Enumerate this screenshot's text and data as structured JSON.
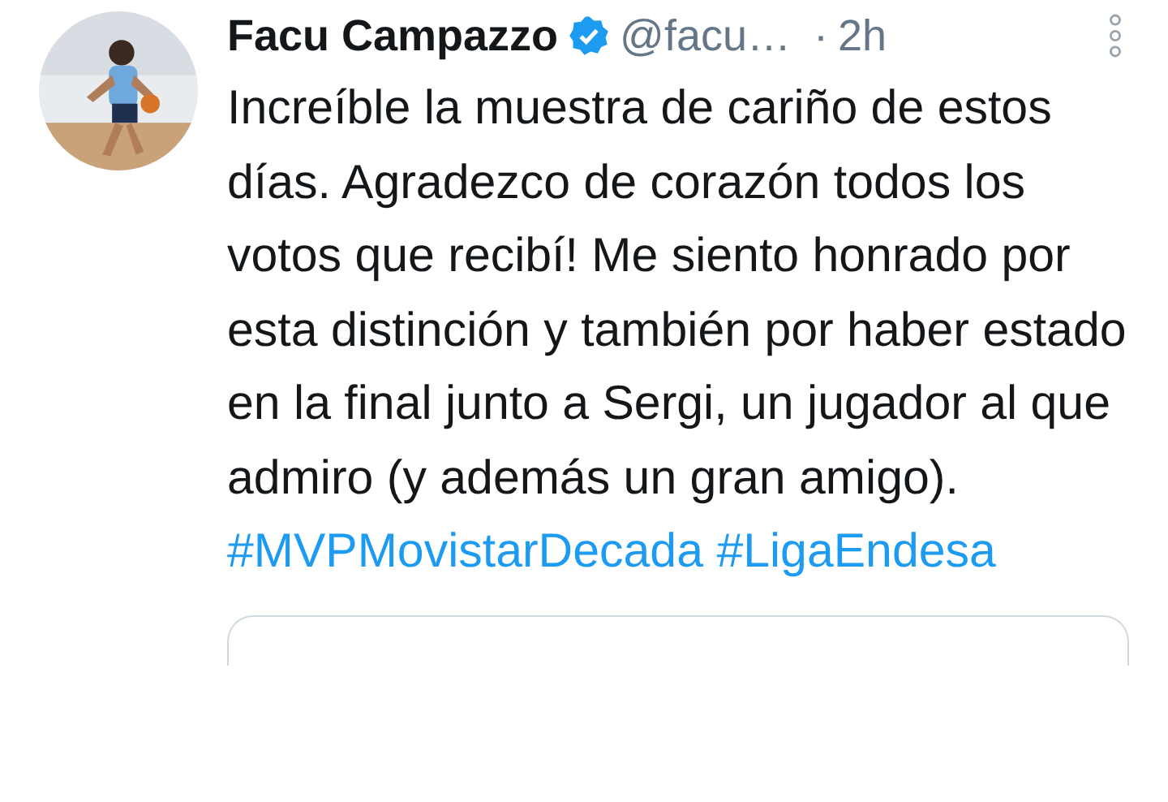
{
  "author": {
    "name": "Facu Campazzo",
    "verified": true,
    "handle": "@facu…",
    "separator": "·",
    "time": "2h"
  },
  "tweet": {
    "text": "Increíble la muestra de cariño de estos días. Agradezco de corazón todos los votos que recibí! Me siento honrado por esta distinción y también por haber estado en la final junto a Sergi, un jugador al que admiro (y además un gran amigo).",
    "hashtags": [
      "#MVPMovistarDecada",
      "#LigaEndesa"
    ]
  }
}
